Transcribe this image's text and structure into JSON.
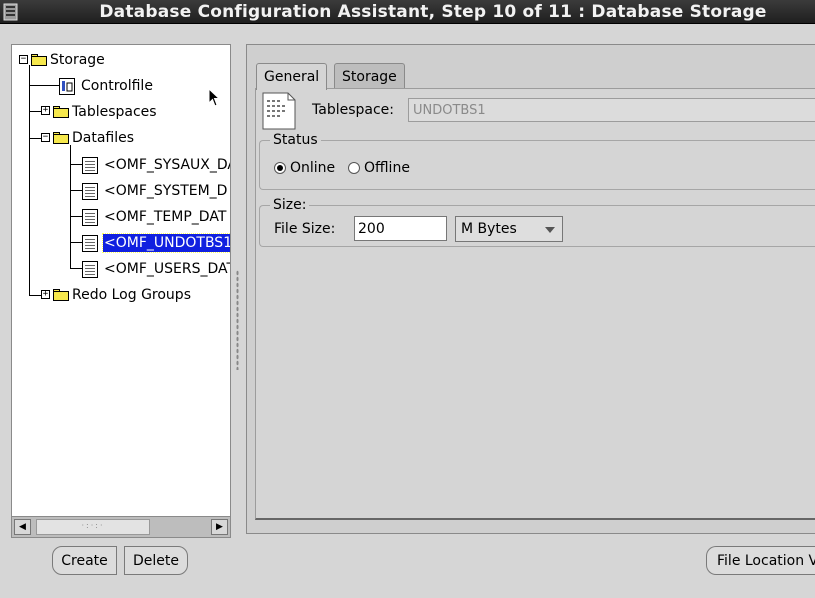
{
  "window": {
    "title": "Database Configuration Assistant, Step 10 of 11 : Database Storage"
  },
  "tree": {
    "root": "Storage",
    "controlfile": "Controlfile",
    "tablespaces": "Tablespaces",
    "datafiles": "Datafiles",
    "datafile_items": [
      "<OMF_SYSAUX_DA",
      "<OMF_SYSTEM_D",
      "<OMF_TEMP_DAT",
      "<OMF_UNDOTBS1",
      "<OMF_USERS_DAT"
    ],
    "redo_log_groups": "Redo Log Groups",
    "selected_item": "<OMF_UNDOTBS1"
  },
  "tabs": [
    "General",
    "Storage"
  ],
  "general": {
    "tablespace_label": "Tablespace:",
    "tablespace_value": "UNDOTBS1",
    "status_legend": "Status",
    "online_label": "Online",
    "offline_label": "Offline",
    "status_selected": "Online",
    "size_legend": "Size:",
    "file_size_label": "File Size:",
    "file_size_value": "200",
    "unit_value": "M Bytes"
  },
  "buttons": {
    "create": "Create",
    "delete": "Delete",
    "file_location": "File Location V"
  },
  "colors": {
    "selection": "#1020e0",
    "folder": "#f6e84d",
    "titlebar": "#2b2b2b"
  }
}
